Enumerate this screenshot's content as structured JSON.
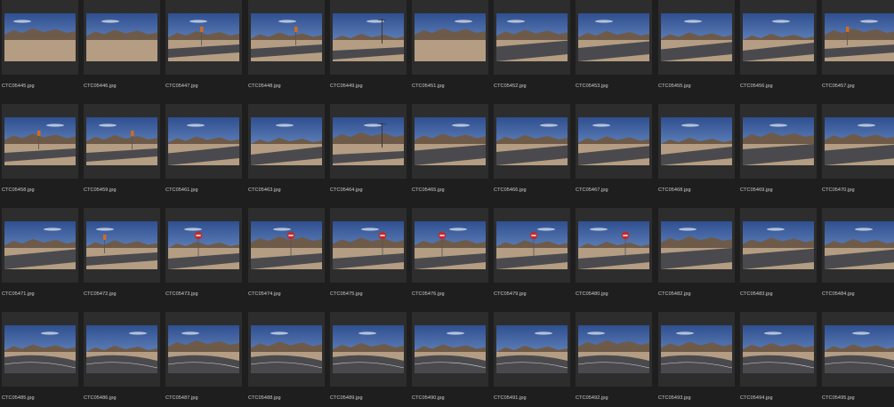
{
  "thumbnail_scene": "desert-road-photo",
  "colors": {
    "background": "#1e1e1e",
    "card": "#2d2d2d",
    "filename_text": "#cfcfcf",
    "sky_top": "#2f4f8f",
    "sky_bottom": "#7fa3d6",
    "mountain": "#6e5a48",
    "ground": "#b49d82",
    "road": "#4a4a4e",
    "stop_sign": "#c4282a",
    "orange_sign": "#d66a1c"
  },
  "rows": [
    {
      "items": [
        {
          "filename": "CTC05445.jpg",
          "scene": "plain"
        },
        {
          "filename": "CTC05446.jpg",
          "scene": "plain"
        },
        {
          "filename": "CTC05447.jpg",
          "scene": "orange-sign"
        },
        {
          "filename": "CTC05448.jpg",
          "scene": "orange-sign"
        },
        {
          "filename": "CTC05449.jpg",
          "scene": "pole"
        },
        {
          "filename": "CTC05451.jpg",
          "scene": "plain"
        },
        {
          "filename": "CTC05452.jpg",
          "scene": "road"
        },
        {
          "filename": "CTC05453.jpg",
          "scene": "road"
        },
        {
          "filename": "CTC05455.jpg",
          "scene": "road"
        },
        {
          "filename": "CTC05456.jpg",
          "scene": "road"
        },
        {
          "filename": "CTC05457.jpg",
          "scene": "orange-sign"
        }
      ]
    },
    {
      "items": [
        {
          "filename": "CTC05458.jpg",
          "scene": "orange-sign"
        },
        {
          "filename": "CTC05459.jpg",
          "scene": "orange-sign"
        },
        {
          "filename": "CTC05461.jpg",
          "scene": "road"
        },
        {
          "filename": "CTC05463.jpg",
          "scene": "road"
        },
        {
          "filename": "CTC05464.jpg",
          "scene": "pole"
        },
        {
          "filename": "CTC05465.jpg",
          "scene": "road"
        },
        {
          "filename": "CTC05466.jpg",
          "scene": "road"
        },
        {
          "filename": "CTC05467.jpg",
          "scene": "road"
        },
        {
          "filename": "CTC05468.jpg",
          "scene": "road"
        },
        {
          "filename": "CTC05469.jpg",
          "scene": "road"
        },
        {
          "filename": "CTC05470.jpg",
          "scene": "road"
        }
      ]
    },
    {
      "items": [
        {
          "filename": "CTC05471.jpg",
          "scene": "road"
        },
        {
          "filename": "CTC05472.jpg",
          "scene": "orange-sign"
        },
        {
          "filename": "CTC05473.jpg",
          "scene": "stop"
        },
        {
          "filename": "CTC05474.jpg",
          "scene": "stop"
        },
        {
          "filename": "CTC05475.jpg",
          "scene": "stop"
        },
        {
          "filename": "CTC05476.jpg",
          "scene": "stop"
        },
        {
          "filename": "CTC05479.jpg",
          "scene": "stop"
        },
        {
          "filename": "CTC05480.jpg",
          "scene": "stop"
        },
        {
          "filename": "CTC05482.jpg",
          "scene": "road"
        },
        {
          "filename": "CTC05483.jpg",
          "scene": "road"
        },
        {
          "filename": "CTC05484.jpg",
          "scene": "road"
        }
      ]
    },
    {
      "items": [
        {
          "filename": "CTC05485.jpg",
          "scene": "curve"
        },
        {
          "filename": "CTC05486.jpg",
          "scene": "curve"
        },
        {
          "filename": "CTC05487.jpg",
          "scene": "curve"
        },
        {
          "filename": "CTC05488.jpg",
          "scene": "curve"
        },
        {
          "filename": "CTC05489.jpg",
          "scene": "curve"
        },
        {
          "filename": "CTC05490.jpg",
          "scene": "curve"
        },
        {
          "filename": "CTC05491.jpg",
          "scene": "curve"
        },
        {
          "filename": "CTC05492.jpg",
          "scene": "curve"
        },
        {
          "filename": "CTC05493.jpg",
          "scene": "curve"
        },
        {
          "filename": "CTC05494.jpg",
          "scene": "curve"
        },
        {
          "filename": "CTC05495.jpg",
          "scene": "curve"
        }
      ]
    }
  ]
}
